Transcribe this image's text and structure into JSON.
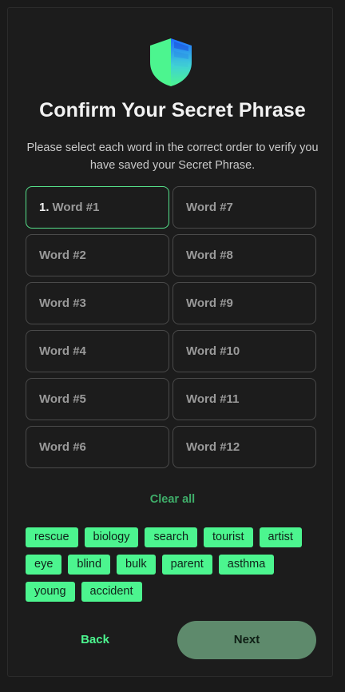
{
  "header": {
    "logo_icon": "shield-icon",
    "title": "Confirm Your Secret Phrase",
    "subtitle": "Please select each word in the correct order to verify you have saved your Secret Phrase."
  },
  "slots": [
    {
      "number": "1.",
      "label": "Word #1",
      "active": true
    },
    {
      "label": "Word #2"
    },
    {
      "label": "Word #3"
    },
    {
      "label": "Word #4"
    },
    {
      "label": "Word #5"
    },
    {
      "label": "Word #6"
    },
    {
      "label": "Word #7"
    },
    {
      "label": "Word #8"
    },
    {
      "label": "Word #9"
    },
    {
      "label": "Word #10"
    },
    {
      "label": "Word #11"
    },
    {
      "label": "Word #12"
    }
  ],
  "actions": {
    "clear_all": "Clear all",
    "back": "Back",
    "next": "Next"
  },
  "word_bank": [
    "rescue",
    "biology",
    "search",
    "tourist",
    "artist",
    "eye",
    "blind",
    "bulk",
    "parent",
    "asthma",
    "young",
    "accident"
  ],
  "colors": {
    "accent": "#4cf58f",
    "active_border": "#55e08a",
    "next_button": "#5e8a6c",
    "background": "#1c1c1c"
  }
}
